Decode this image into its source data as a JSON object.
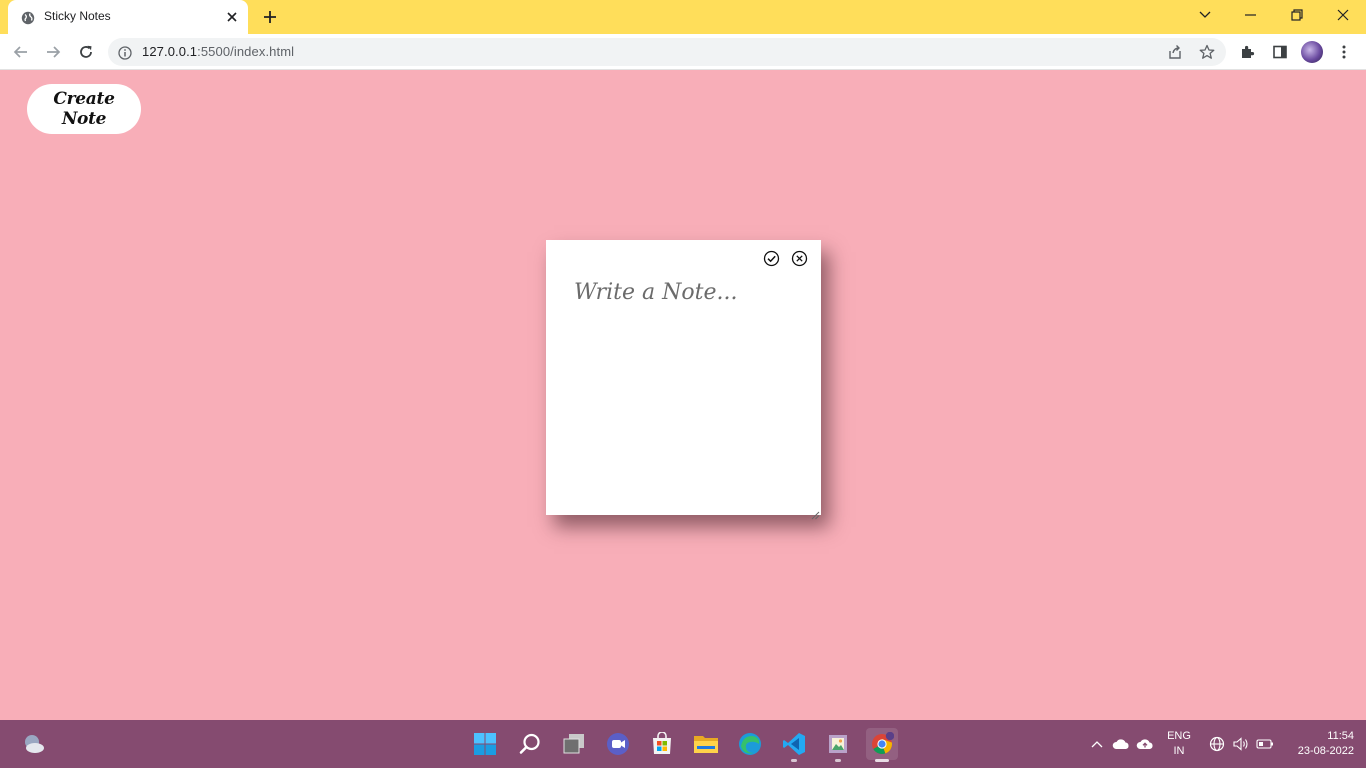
{
  "browser": {
    "tab": {
      "title": "Sticky Notes",
      "favicon": "globe-icon"
    },
    "url": {
      "host": "127.0.0.1",
      "rest": ":5500/index.html"
    },
    "window_controls": [
      "chevron-down-icon",
      "minimize-icon",
      "restore-icon",
      "close-icon"
    ],
    "toolbar_icons": [
      "back-arrow-icon",
      "forward-arrow-icon",
      "reload-icon",
      "share-icon",
      "star-icon",
      "extensions-puzzle-icon",
      "side-panel-icon",
      "profile-avatar",
      "more-menu-icon"
    ]
  },
  "page": {
    "background_color": "#f8aeb8",
    "create_note_label": "Create Note",
    "note": {
      "placeholder": "Write a Note...",
      "value": "",
      "actions": [
        "check-circle-icon",
        "close-circle-icon"
      ]
    }
  },
  "taskbar": {
    "background_color": "#854b70",
    "pinned": [
      "widgets-weather-icon",
      "windows-start-icon",
      "search-icon",
      "task-view-icon",
      "teams-chat-icon",
      "microsoft-store-icon",
      "file-explorer-icon",
      "edge-icon",
      "vscode-icon",
      "image-viewer-icon",
      "chrome-icon"
    ],
    "tray": {
      "icons": [
        "chevron-up-icon",
        "onedrive-cloud-icon",
        "cloud-upload-icon",
        "network-globe-icon",
        "volume-icon",
        "battery-icon"
      ],
      "lang_line1": "ENG",
      "lang_line2": "IN",
      "time": "11:54",
      "date": "23-08-2022"
    }
  },
  "colors": {
    "titlebar": "#ffde5a",
    "accent_chrome": "#1a73e8"
  }
}
